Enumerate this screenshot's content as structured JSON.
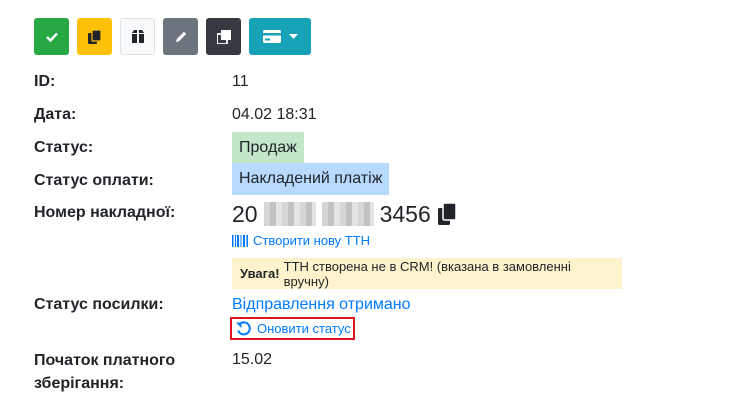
{
  "toolbar": {
    "buttons": [
      {
        "name": "confirm-button",
        "icon": "check-icon",
        "color": "#28a745"
      },
      {
        "name": "copy-button",
        "icon": "copy-icon",
        "color": "#ffc107"
      },
      {
        "name": "box-button",
        "icon": "box-icon",
        "color": "#f8f9fa"
      },
      {
        "name": "edit-button",
        "icon": "pencil-icon",
        "color": "#6c757d"
      },
      {
        "name": "duplicate-button",
        "icon": "clone-icon",
        "color": "#343a40"
      },
      {
        "name": "payment-dropdown-button",
        "icon": "credit-card-icon",
        "color": "#17a2b8"
      }
    ]
  },
  "fields": {
    "id_label": "ID:",
    "id_value": "11",
    "date_label": "Дата:",
    "date_value": "04.02 18:31",
    "status_label": "Статус:",
    "status_value": "Продаж",
    "payment_status_label": "Статус оплати:",
    "payment_status_value": "Накладений платіж",
    "waybill_label": "Номер накладної:",
    "waybill_prefix": "20",
    "waybill_suffix": "3456",
    "create_ttn_link": "Створити нову ТТН",
    "warning_bold": "Увага!",
    "warning_text": "ТТН створена не в CRM! (вказана в замовленні вручну)",
    "parcel_status_label": "Статус посилки:",
    "parcel_status_value": "Відправлення отримано",
    "refresh_status_link": "Оновити статус",
    "storage_label": "Початок платного зберігання:",
    "storage_value": "15.02"
  },
  "colors": {
    "link": "#007bff",
    "status_badge": "#c3e6cb",
    "payment_badge": "#b8daff",
    "warning_bg": "#fff3cd",
    "highlight_border": "#e0141e"
  }
}
